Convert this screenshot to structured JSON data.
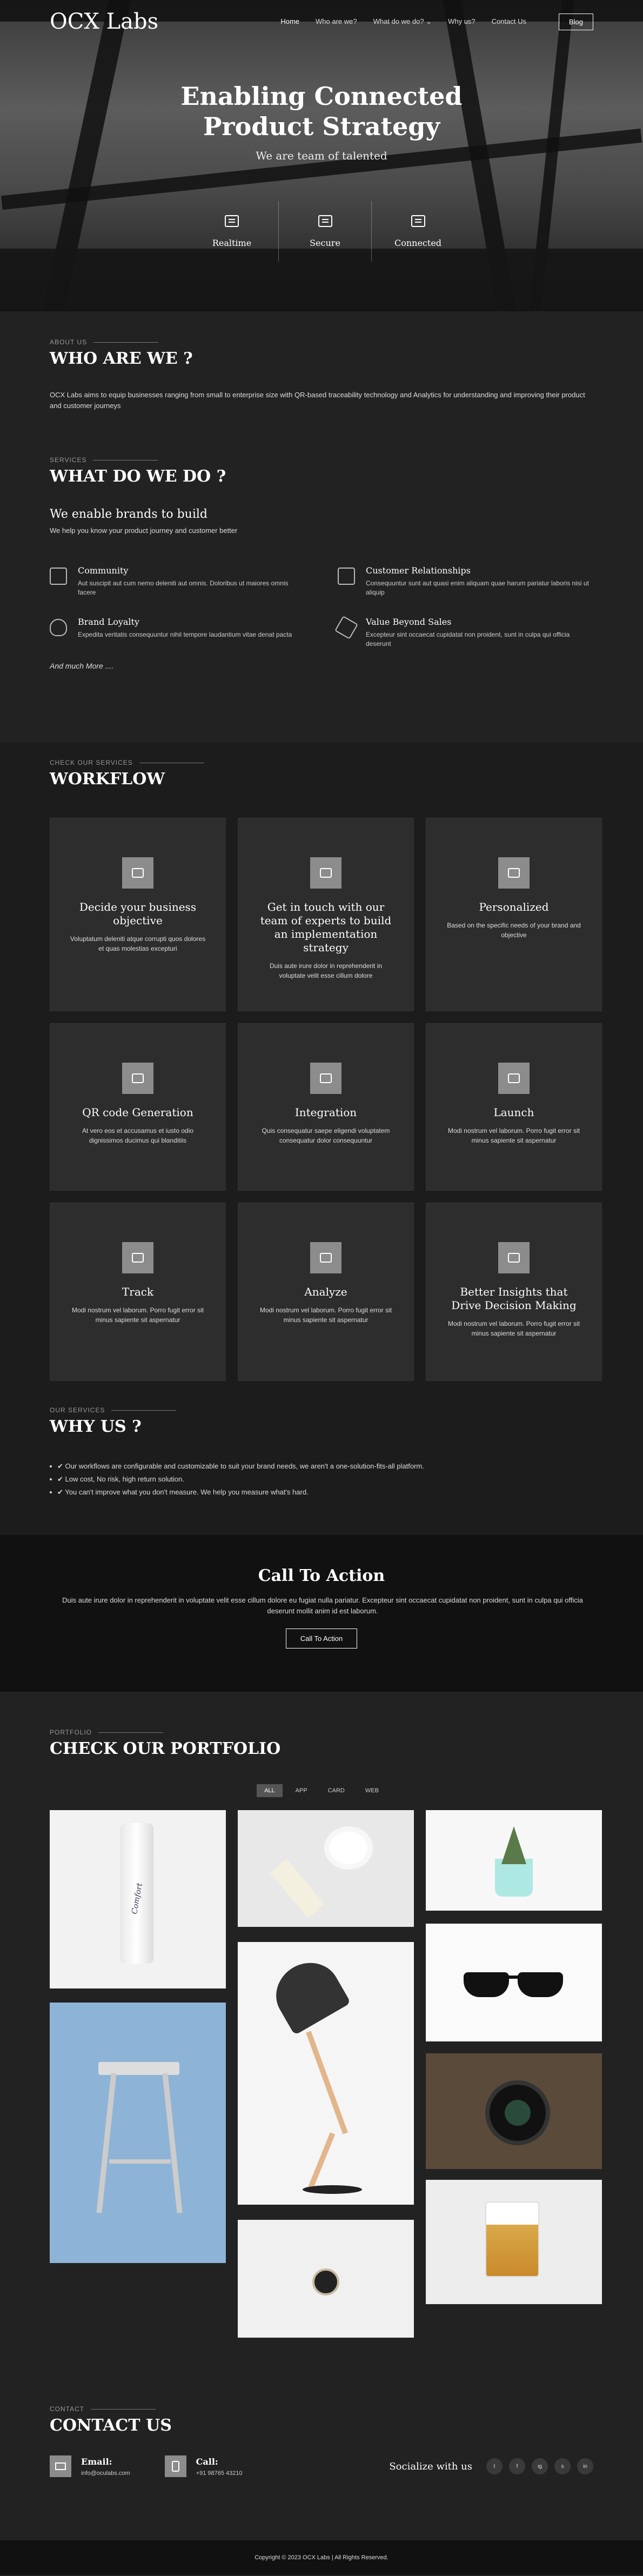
{
  "nav": {
    "logo": "OCX Labs",
    "items": [
      "Home",
      "Who are we?",
      "What do we do? ⌄",
      "Why us?",
      "Contact Us"
    ],
    "blog": "Blog"
  },
  "hero": {
    "title_line1": "Enabling Connected",
    "title_line2": "Product Strategy",
    "subtitle": "We are team of talented",
    "features": [
      {
        "label": "Realtime",
        "icon": "dashboard-icon"
      },
      {
        "label": "Secure",
        "icon": "secure-doc-icon"
      },
      {
        "label": "Connected",
        "icon": "connected-icon"
      }
    ]
  },
  "about": {
    "eyebrow": "ABOUT US",
    "title": "WHO ARE WE ?",
    "text": "OCX Labs aims to equip businesses ranging from small to enterprise size with QR-based traceability technology and Analytics for understanding and improving their product and customer journeys"
  },
  "services": {
    "eyebrow": "SERVICES",
    "title": "WHAT DO WE DO ?",
    "subtitle": "We enable brands to build",
    "subtext": "We help you know your product journey and customer better",
    "items": [
      {
        "title": "Community",
        "desc": "Aut suscipit aut cum nemo deleniti aut omnis. Doloribus ut maiores omnis facere",
        "icon": "community-icon"
      },
      {
        "title": "Customer Relationships",
        "desc": "Consequuntur sunt aut quasi enim aliquam quae harum pariatur laboris nisi ut aliquip",
        "icon": "customer-relationships-icon"
      },
      {
        "title": "Brand Loyalty",
        "desc": "Expedita veritatis consequuntur nihil tempore laudantium vitae denat pacta",
        "icon": "shield-icon"
      },
      {
        "title": "Value Beyond Sales",
        "desc": "Excepteur sint occaecat cupidatat non proident, sunt in culpa qui officia deserunt",
        "icon": "cube-icon"
      }
    ],
    "more": "And much More ...."
  },
  "workflow": {
    "eyebrow": "CHECK OUR SERVICES",
    "title": "WORKFLOW",
    "cards": [
      {
        "title": "Decide your business objective",
        "desc": "Voluptatum deleniti atque corrupti quos dolores et quas molestias excepturi",
        "icon": "briefcase-icon"
      },
      {
        "title": "Get in touch with our team of experts to build an implementation strategy",
        "desc": "Duis aute irure dolor in reprehenderit in voluptate velit esse cillum dolore",
        "icon": "team-icon"
      },
      {
        "title": "Personalized",
        "desc": "Based on the specific needs of your brand and objective",
        "icon": "personalized-icon"
      },
      {
        "title": "QR code Generation",
        "desc": "At vero eos et accusamus et iusto odio dignissimos ducimus qui blanditiis",
        "icon": "qr-code-icon"
      },
      {
        "title": "Integration",
        "desc": "Quis consequatur saepe eligendi voluptatem consequatur dolor consequuntur",
        "icon": "integration-icon"
      },
      {
        "title": "Launch",
        "desc": "Modi nostrum vel laborum. Porro fugit error sit minus sapiente sit aspernatur",
        "icon": "rocket-icon"
      },
      {
        "title": "Track",
        "desc": "Modi nostrum vel laborum. Porro fugit error sit minus sapiente sit aspernatur",
        "icon": "track-icon"
      },
      {
        "title": "Analyze",
        "desc": "Modi nostrum vel laborum. Porro fugit error sit minus sapiente sit aspernatur",
        "icon": "bar-chart-icon"
      },
      {
        "title": "Better Insights that Drive Decision Making",
        "desc": "Modi nostrum vel laborum. Porro fugit error sit minus sapiente sit aspernatur",
        "icon": "insights-icon"
      }
    ]
  },
  "why": {
    "eyebrow": "OUR SERVICES",
    "title": "WHY US ?",
    "items": [
      "✔ Our workflows are configurable and customizable to suit your brand needs, we aren't a one-solution-fits-all platform.",
      "✔ Low cost, No risk, high return solution.",
      "✔ You can't improve what you don't measure. We help you measure what's hard."
    ]
  },
  "cta": {
    "title": "Call To Action",
    "text": "Duis aute irure dolor in reprehenderit in voluptate velit esse cillum dolore eu fugiat nulla pariatur. Excepteur sint occaecat cupidatat non proident, sunt in culpa qui officia deserunt mollit anim id est laborum.",
    "button": "Call To Action"
  },
  "portfolio": {
    "eyebrow": "PORTFOLIO",
    "title": "CHECK OUR PORTFOLIO",
    "filters": [
      "ALL",
      "APP",
      "CARD",
      "WEB"
    ],
    "bottle_label": "Comfort"
  },
  "contact": {
    "eyebrow": "CONTACT",
    "title": "CONTACT US",
    "email_label": "Email:",
    "email": "info@oculabs.com",
    "call_label": "Call:",
    "phone": "+91 98765 43210",
    "social_label": "Socialize with us",
    "social": [
      "t",
      "f",
      "ig",
      "s",
      "in"
    ]
  },
  "footer": {
    "copyright": "Copyright © 2023 OCX Labs | All Rights Reserved."
  }
}
